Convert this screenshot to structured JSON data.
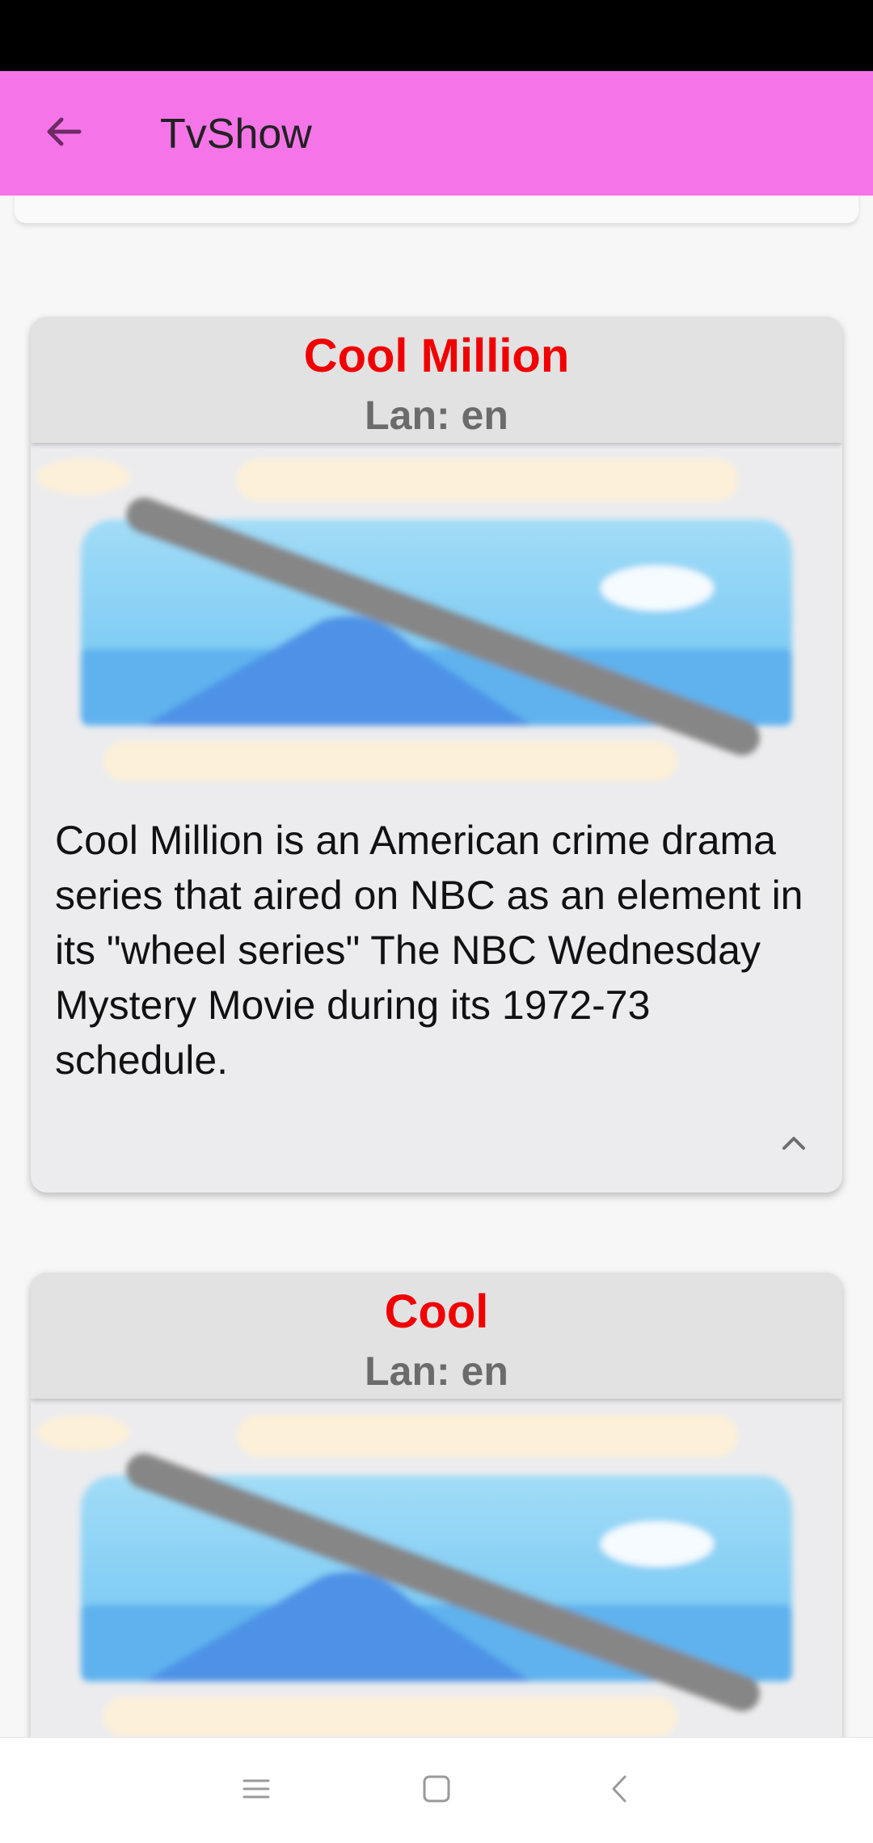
{
  "app_bar": {
    "title": "TvShow",
    "background": "#f575e8",
    "back_icon": "arrow-back-icon"
  },
  "shows": [
    {
      "title": "Cool Million",
      "language": "Lan: en",
      "image_icon": "broken-image-icon",
      "description": "Cool Million is an American crime drama series that aired on NBC as an element in its \"wheel series\" The NBC Wednesday Mystery Movie during its 1972-73 schedule.",
      "toggle_icon": "chevron-up-icon"
    },
    {
      "title": "Cool",
      "language": "Lan: en",
      "image_icon": "broken-image-icon"
    }
  ],
  "colors": {
    "title_red": "#f00000",
    "card_bg": "#ececee",
    "header_bg": "#e2e2e2"
  },
  "nav_bar": {
    "menu_icon": "menu-icon",
    "home_icon": "home-square-icon",
    "back_icon": "nav-back-icon"
  }
}
